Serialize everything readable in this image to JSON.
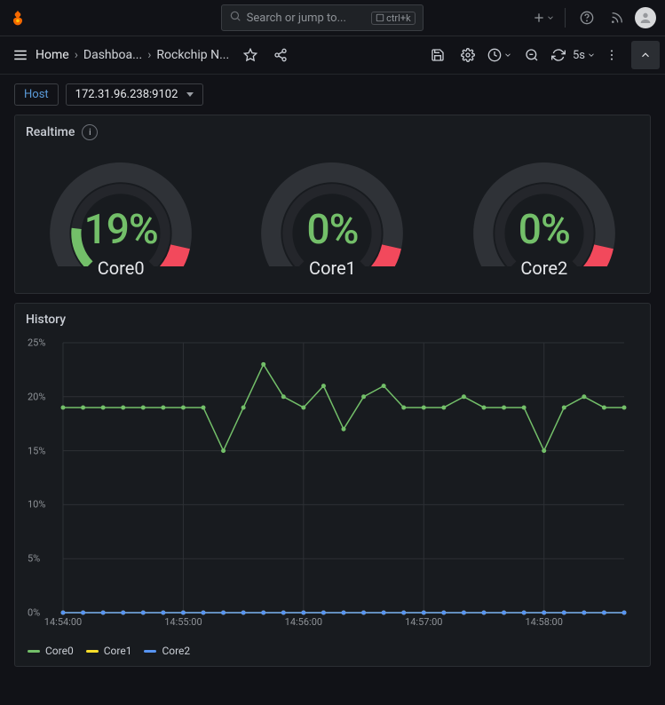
{
  "header": {
    "search_placeholder": "Search or jump to...",
    "shortcut_label": "ctrl+k"
  },
  "toolbar": {
    "crumbs": [
      "Home",
      "Dashboa...",
      "Rockchip N..."
    ],
    "refresh_interval": "5s"
  },
  "vars": {
    "label": "Host",
    "value": "172.31.96.238:9102"
  },
  "realtime": {
    "title": "Realtime",
    "gauges": [
      {
        "label": "Core0",
        "value": "19%",
        "pct": 19
      },
      {
        "label": "Core1",
        "value": "0%",
        "pct": 0
      },
      {
        "label": "Core2",
        "value": "0%",
        "pct": 0
      }
    ]
  },
  "history": {
    "title": "History",
    "y_ticks": [
      "25%",
      "20%",
      "15%",
      "10%",
      "5%",
      "0%"
    ],
    "x_ticks": [
      "14:54:00",
      "14:55:00",
      "14:56:00",
      "14:57:00",
      "14:58:00"
    ],
    "legend": [
      "Core0",
      "Core1",
      "Core2"
    ]
  },
  "chart_data": [
    {
      "type": "gauge",
      "title": "Realtime",
      "series": [
        {
          "name": "Core0",
          "value": 19,
          "unit": "%"
        },
        {
          "name": "Core1",
          "value": 0,
          "unit": "%"
        },
        {
          "name": "Core2",
          "value": 0,
          "unit": "%"
        }
      ],
      "range": [
        0,
        100
      ]
    },
    {
      "type": "line",
      "title": "History",
      "ylabel": "",
      "ylim": [
        0,
        25
      ],
      "y_unit": "%",
      "x": [
        "14:54:00",
        "14:54:10",
        "14:54:20",
        "14:54:30",
        "14:54:40",
        "14:54:50",
        "14:55:00",
        "14:55:10",
        "14:55:20",
        "14:55:30",
        "14:55:40",
        "14:55:50",
        "14:56:00",
        "14:56:10",
        "14:56:20",
        "14:56:30",
        "14:56:40",
        "14:56:50",
        "14:57:00",
        "14:57:10",
        "14:57:20",
        "14:57:30",
        "14:57:40",
        "14:57:50",
        "14:58:00",
        "14:58:10",
        "14:58:20",
        "14:58:30",
        "14:58:40"
      ],
      "series": [
        {
          "name": "Core0",
          "values": [
            19,
            19,
            19,
            19,
            19,
            19,
            19,
            19,
            15,
            19,
            23,
            20,
            19,
            21,
            17,
            20,
            21,
            19,
            19,
            19,
            20,
            19,
            19,
            19,
            15,
            19,
            20,
            19,
            19
          ]
        },
        {
          "name": "Core1",
          "values": [
            0,
            0,
            0,
            0,
            0,
            0,
            0,
            0,
            0,
            0,
            0,
            0,
            0,
            0,
            0,
            0,
            0,
            0,
            0,
            0,
            0,
            0,
            0,
            0,
            0,
            0,
            0,
            0,
            0
          ]
        },
        {
          "name": "Core2",
          "values": [
            0,
            0,
            0,
            0,
            0,
            0,
            0,
            0,
            0,
            0,
            0,
            0,
            0,
            0,
            0,
            0,
            0,
            0,
            0,
            0,
            0,
            0,
            0,
            0,
            0,
            0,
            0,
            0,
            0
          ]
        }
      ]
    }
  ]
}
